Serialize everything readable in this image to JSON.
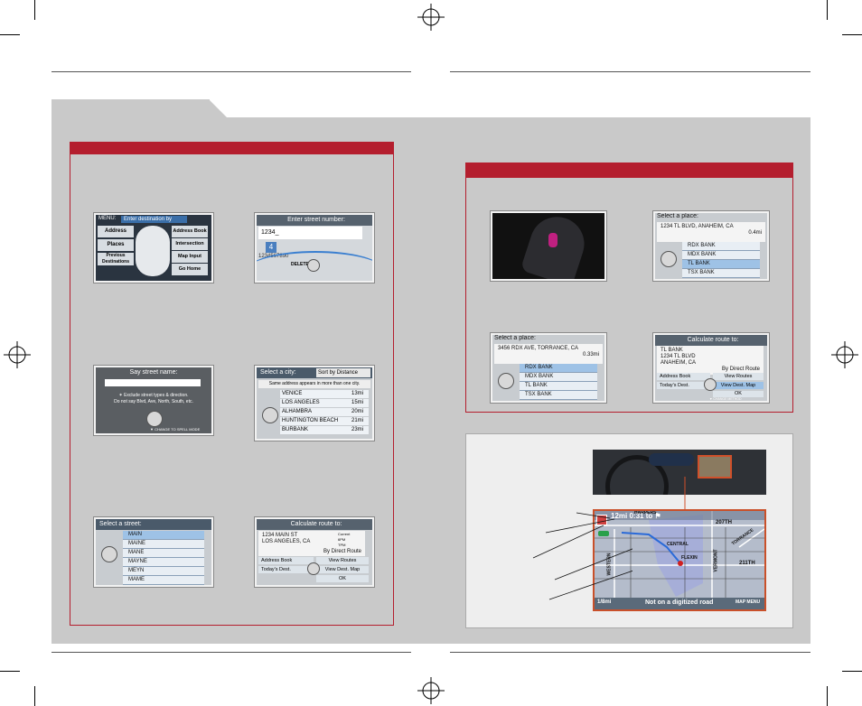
{
  "screens": {
    "menu": {
      "header": "MENU:",
      "tab": "Enter destination by",
      "left_items": [
        "Address",
        "Places",
        "Previous Destinations"
      ],
      "right_items": [
        "Address Book",
        "Intersection",
        "Map Input",
        "Go Home"
      ]
    },
    "street_number": {
      "title": "Enter street number:",
      "value": "1234_",
      "highlight": "4",
      "digits": "1234567890",
      "delete": "DELETE"
    },
    "say_street": {
      "title": "Say street name:",
      "hint1": "✶ Exclude street types & direction.",
      "hint2": "Do not say Blvd, Ave, North, South, etc.",
      "hint3": "▼ CHANGE TO SPELL MODE"
    },
    "select_city": {
      "title": "Select a city:",
      "sort": "Sort by Distance",
      "subtitle": "Same address appears in more than one city.",
      "cities": [
        {
          "name": "VENICE",
          "dist": "13mi"
        },
        {
          "name": "LOS ANGELES",
          "dist": "15mi"
        },
        {
          "name": "ALHAMBRA",
          "dist": "20mi"
        },
        {
          "name": "HUNTINGTON BEACH",
          "dist": "21mi"
        },
        {
          "name": "BURBANK",
          "dist": "23mi"
        }
      ]
    },
    "select_street": {
      "title": "Select a street:",
      "streets": [
        "MAIN",
        "MAINE",
        "MANE",
        "MAYNE",
        "MEYN",
        "MAME"
      ]
    },
    "calc_route_1": {
      "title": "Calculate route to:",
      "address1": "1234 MAIN ST",
      "address2": "LOS ANGELES, CA",
      "by": "By Direct Route",
      "left": [
        "Address Book",
        "Today's Dest."
      ],
      "right": [
        "View Routes",
        "View Dest. Map",
        "OK"
      ],
      "side": [
        "Current",
        "6PM",
        "TPM"
      ]
    },
    "select_place_1": {
      "title": "Select a place:",
      "address": "1234 TL BLVD, ANAHEIM, CA",
      "dist": "0.4mi",
      "places": [
        "RDX BANK",
        "MDX BANK",
        "TL BANK",
        "TSX BANK"
      ]
    },
    "select_place_2": {
      "title": "Select a place:",
      "address": "3456 RDX AVE, TORRANCE, CA",
      "dist": "0.33mi",
      "places": [
        "RDX BANK",
        "MDX BANK",
        "TL BANK",
        "TSX BANK"
      ]
    },
    "calc_route_2": {
      "title": "Calculate route to:",
      "address1": "TL BANK",
      "address2": "1234 TL BLVD",
      "address3": "ANAHEIM, CA",
      "by": "By Direct Route",
      "left": [
        "Address Book",
        "Today's Dest."
      ],
      "right": [
        "View Routes",
        "View Dest. Map",
        "OK"
      ],
      "footer": "▼ CHANGE METHOD"
    },
    "map": {
      "eta": "12mi 0:31 to ⚑",
      "streets": [
        "HARPERS",
        "207TH",
        "CENTRAL",
        "FLEXIN",
        "TORRANCE",
        "211TH",
        "WESTERN",
        "VERMONT"
      ],
      "scale": "1/8mi",
      "status": "Not on a digitized road",
      "menu": "MAP MENU"
    }
  }
}
